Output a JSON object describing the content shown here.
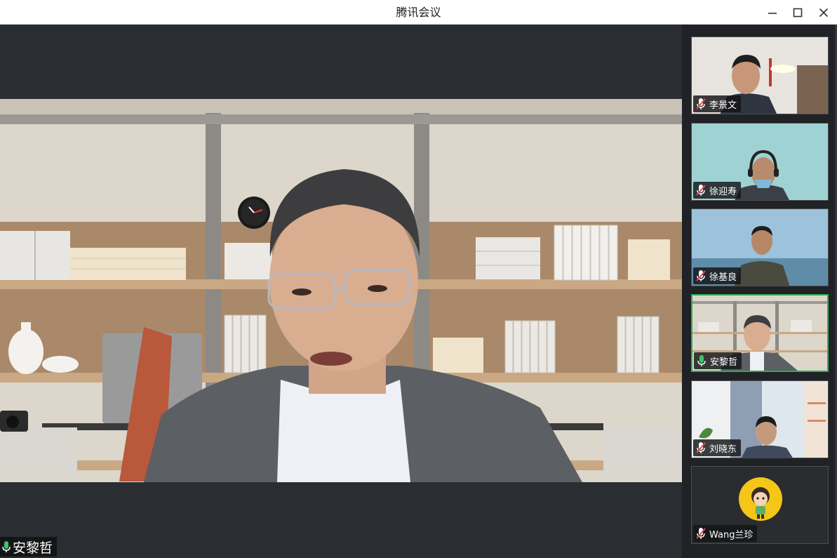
{
  "window": {
    "title": "腾讯会议"
  },
  "main_speaker": {
    "name": "安黎哲",
    "mic": "on"
  },
  "participants": [
    {
      "name": "李景文",
      "mic": "muted"
    },
    {
      "name": "徐迎寿",
      "mic": "muted"
    },
    {
      "name": "徐基良",
      "mic": "muted"
    },
    {
      "name": "安黎哲",
      "mic": "on",
      "active": true
    },
    {
      "name": "刘晓东",
      "mic": "muted"
    },
    {
      "name": "Wang兰珍",
      "mic": "muted",
      "avatar": "cartoon-avatar"
    }
  ],
  "colors": {
    "titlebar_bg": "#ffffff",
    "panel_bg": "#202226",
    "active_speaker_border": "#2fae55",
    "mic_on": "#3cc36a",
    "mic_muted": "#e04a4a",
    "avatar_bg": "#f5c518"
  }
}
